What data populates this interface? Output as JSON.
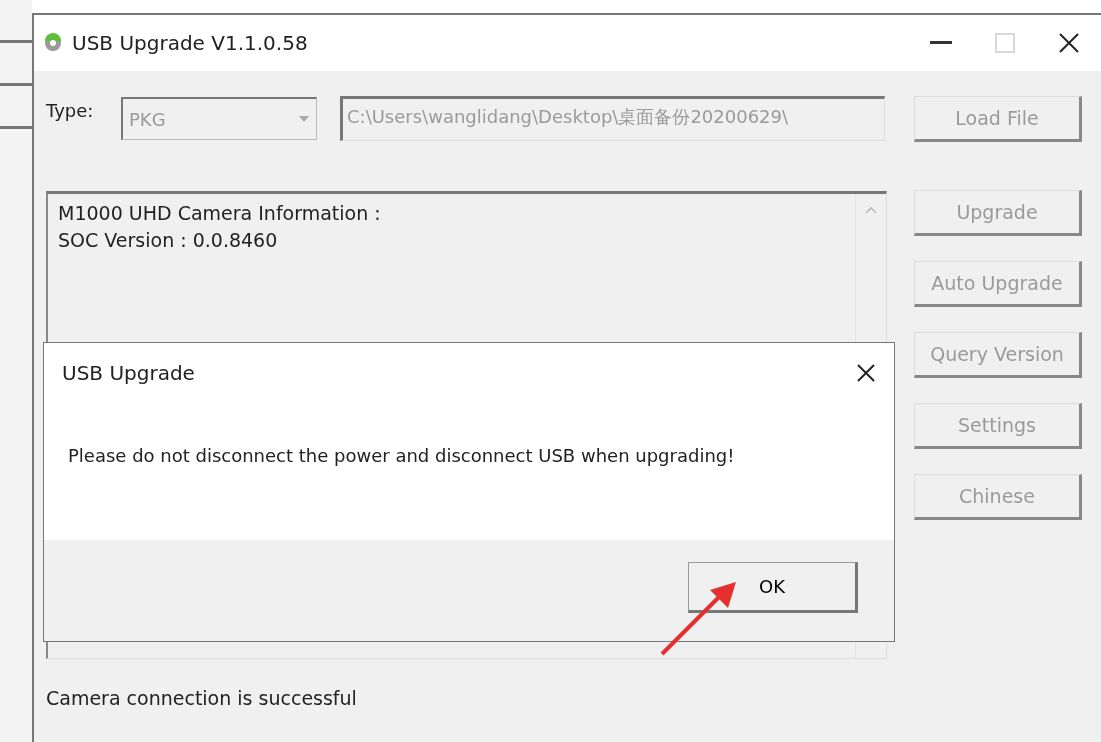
{
  "window": {
    "title": "USB Upgrade V1.1.0.58",
    "maximize_disabled": true
  },
  "type_field": {
    "label": "Type:",
    "value": "PKG",
    "disabled": true
  },
  "file_path": {
    "value": "C:\\Users\\wanglidang\\Desktop\\桌面备份20200629\\",
    "disabled": true
  },
  "load_button": {
    "label": "Load File",
    "disabled": true
  },
  "info_lines": [
    "M1000 UHD Camera Information :",
    "SOC Version : 0.0.8460"
  ],
  "side_buttons": [
    {
      "label": "Upgrade",
      "disabled": true
    },
    {
      "label": "Auto Upgrade",
      "disabled": true
    },
    {
      "label": "Query Version",
      "disabled": true
    },
    {
      "label": "Settings",
      "disabled": true
    },
    {
      "label": "Chinese",
      "disabled": true
    }
  ],
  "status_bar": {
    "text": "Camera connection is successful"
  },
  "dialog": {
    "title": "USB Upgrade",
    "message": "Please do not disconnect the power and disconnect USB when upgrading!",
    "buttons": [
      {
        "label": "OK",
        "disabled": false
      }
    ]
  }
}
